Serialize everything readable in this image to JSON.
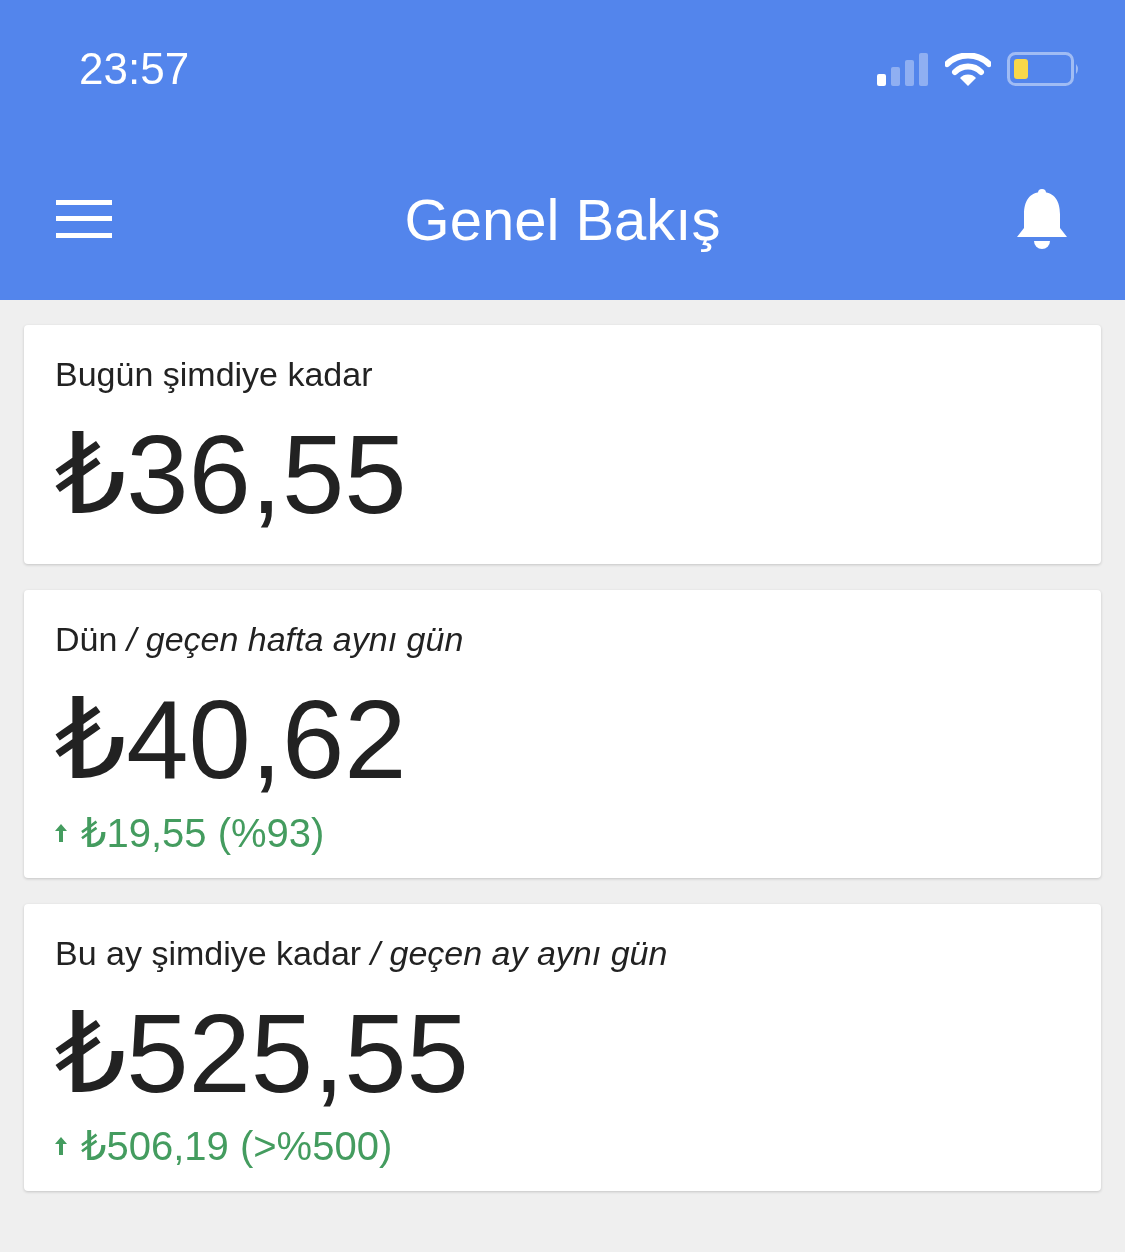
{
  "status_bar": {
    "time": "23:57"
  },
  "header": {
    "title": "Genel Bakış"
  },
  "cards": [
    {
      "title": "Bugün şimdiye kadar",
      "amount": "₺36,55"
    },
    {
      "title": "Dün */ geçen hafta aynı gün*",
      "amount": "₺40,62",
      "change": {
        "kind": "up",
        "text": "₺19,55 (%93)"
      }
    },
    {
      "title": "Bu ay şimdiye kadar */ geçen ay aynı gün*",
      "amount": "₺525,55",
      "change": {
        "kind": "up",
        "text": "₺506,19 (>%500)"
      }
    }
  ]
}
